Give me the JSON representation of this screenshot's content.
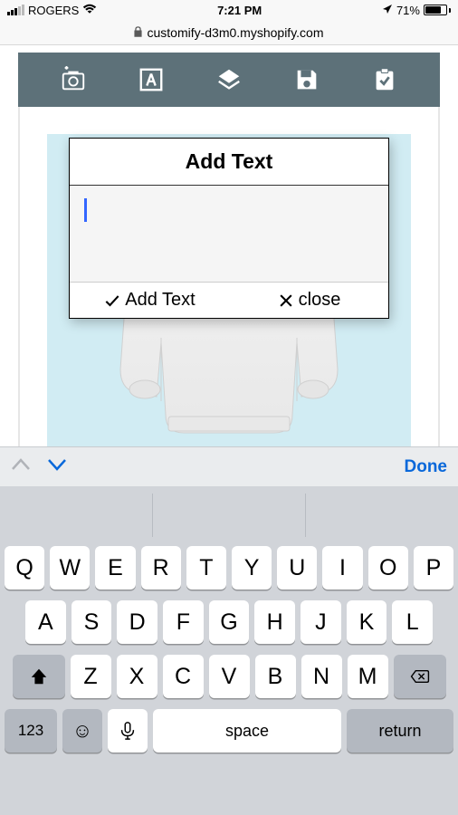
{
  "statusBar": {
    "carrier": "ROGERS",
    "time": "7:21 PM",
    "batteryPercent": "71%"
  },
  "urlBar": {
    "url": "customify-d3m0.myshopify.com"
  },
  "modal": {
    "title": "Add Text",
    "addAction": "Add Text",
    "closeAction": "close"
  },
  "kbToolbar": {
    "done": "Done"
  },
  "keyboard": {
    "row1": [
      "Q",
      "W",
      "E",
      "R",
      "T",
      "Y",
      "U",
      "I",
      "O",
      "P"
    ],
    "row2": [
      "A",
      "S",
      "D",
      "F",
      "G",
      "H",
      "J",
      "K",
      "L"
    ],
    "row3": [
      "Z",
      "X",
      "C",
      "V",
      "B",
      "N",
      "M"
    ],
    "numKey": "123",
    "space": "space",
    "return": "return"
  }
}
